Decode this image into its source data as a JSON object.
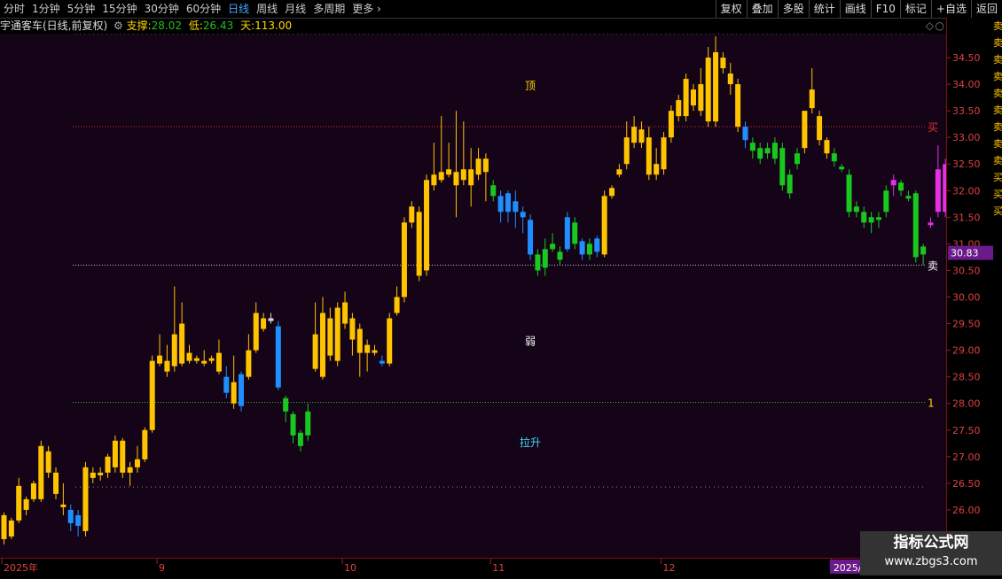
{
  "toolbar": {
    "periods": [
      "分时",
      "1分钟",
      "5分钟",
      "15分钟",
      "30分钟",
      "60分钟",
      "日线",
      "周线",
      "月线",
      "多周期",
      "更多"
    ],
    "active_period": "日线",
    "tools": [
      "复权",
      "叠加",
      "多股",
      "统计",
      "画线",
      "F10",
      "标记",
      "+自选",
      "返回"
    ]
  },
  "info": {
    "stock_label": "宇通客车(日线,前复权)",
    "support_label": "支撑:",
    "support_value": "28.02",
    "low_label": "低:",
    "low_value": "26.43",
    "sky_label": "天:",
    "sky_value": "113.00"
  },
  "colors": {
    "bg": "#150418",
    "yellow": "#ffc400",
    "blue": "#1f8fff",
    "green": "#19c81e",
    "magenta": "#e62ee6",
    "red_line": "#c82828",
    "white_line": "#c8c8c8",
    "green_line": "#1fbf1f"
  },
  "watermark": {
    "line1": "指标公式网",
    "line2": "www.zbgs3.com"
  },
  "signal_strip_text": "卖卖卖卖卖卖卖卖卖买买买"
}
